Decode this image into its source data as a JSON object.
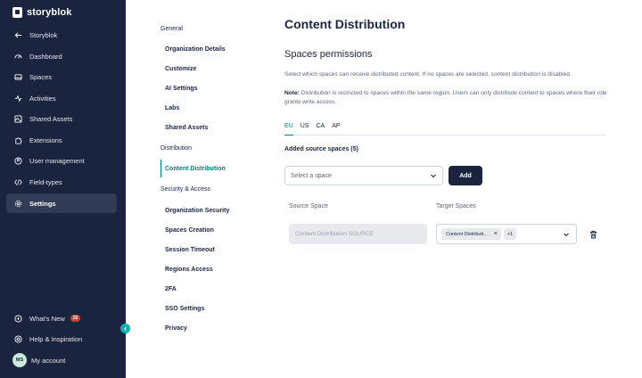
{
  "sidebar": {
    "brand": "storyblok",
    "back_label": "Storyblok",
    "items": [
      {
        "label": "Dashboard",
        "icon": "dashboard-icon"
      },
      {
        "label": "Spaces",
        "icon": "spaces-icon"
      },
      {
        "label": "Activities",
        "icon": "activity-icon"
      },
      {
        "label": "Shared Assets",
        "icon": "image-icon"
      },
      {
        "label": "Extensions",
        "icon": "puzzle-icon"
      },
      {
        "label": "User management",
        "icon": "user-icon"
      },
      {
        "label": "Field-types",
        "icon": "code-icon"
      },
      {
        "label": "Settings",
        "icon": "gear-icon",
        "active": true
      }
    ],
    "bottom": {
      "whats_new": "What's New",
      "whats_new_badge": "25",
      "help": "Help & Inspiration",
      "account_initials": "MS",
      "account": "My account"
    }
  },
  "settings_menu": {
    "general_heading": "General",
    "general_items": [
      "Organization Details",
      "Customize",
      "AI Settings",
      "Labs",
      "Shared Assets"
    ],
    "distribution_heading": "Distribution",
    "distribution_items": [
      "Content Distribution"
    ],
    "security_heading": "Security & Access",
    "security_items": [
      "Organization Security",
      "Spaces Creation",
      "Session Timeout",
      "Regions Access",
      "2FA",
      "SSO Settings",
      "Privacy"
    ],
    "active": "Content Distribution"
  },
  "main": {
    "title": "Content Distribution",
    "section_title": "Spaces permissions",
    "description": "Select which spaces can receive distributed content. If no spaces are selected, content distribution is disabled.",
    "note_label": "Note:",
    "note_text": " Distribution is restricted to spaces within the same region. Users can only distribute content to spaces where their role grants write access.",
    "tabs": [
      "EU",
      "US",
      "CA",
      "AP"
    ],
    "active_tab": "EU",
    "added_label": "Added source spaces (5)",
    "select_placeholder": "Select a space",
    "add_button": "Add",
    "source_header": "Source Space",
    "target_header": "Target Spaces",
    "source_value": "Content Distribution SOURCE",
    "target_chip": "Content Distributi...",
    "target_more": "+1"
  },
  "colors": {
    "sidebar_bg": "#1b243f",
    "accent": "#00807d",
    "badge": "#ed3131"
  }
}
